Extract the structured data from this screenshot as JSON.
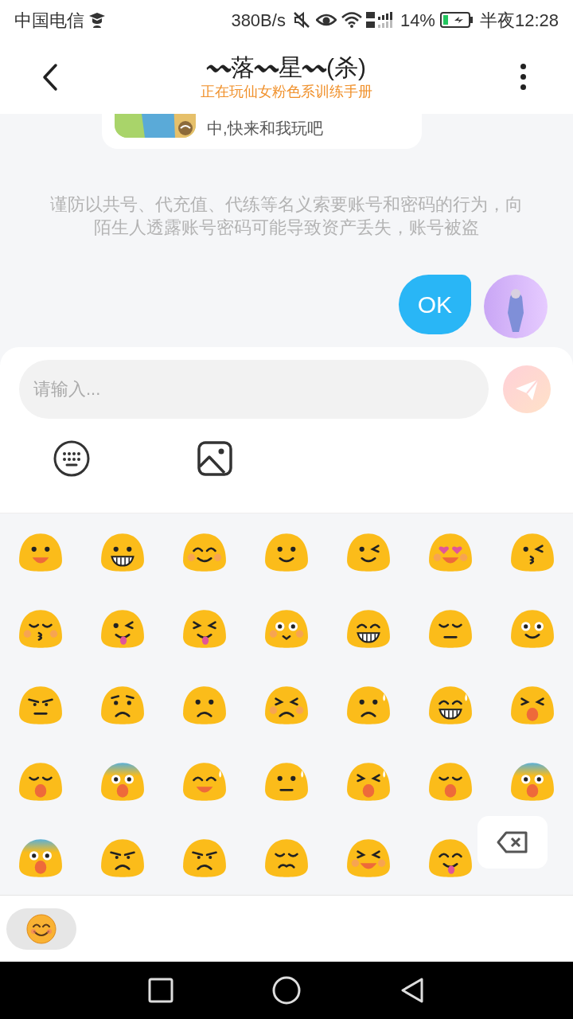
{
  "status_bar": {
    "carrier": "中国电信",
    "network_speed": "380B/s",
    "battery_percent": "14%",
    "time": "半夜12:28"
  },
  "header": {
    "title": "〰落〰星〰(杀)",
    "subtitle": "正在玩仙女粉色系训练手册"
  },
  "card": {
    "text": "中,快来和我玩吧"
  },
  "notice": "谨防以共号、代充值、代练等名义索要账号和密码的行为，向陌生人透露账号密码可能导致资产丢失，账号被盗",
  "messages": [
    {
      "text": "OK"
    }
  ],
  "input": {
    "placeholder": "请输入..."
  }
}
